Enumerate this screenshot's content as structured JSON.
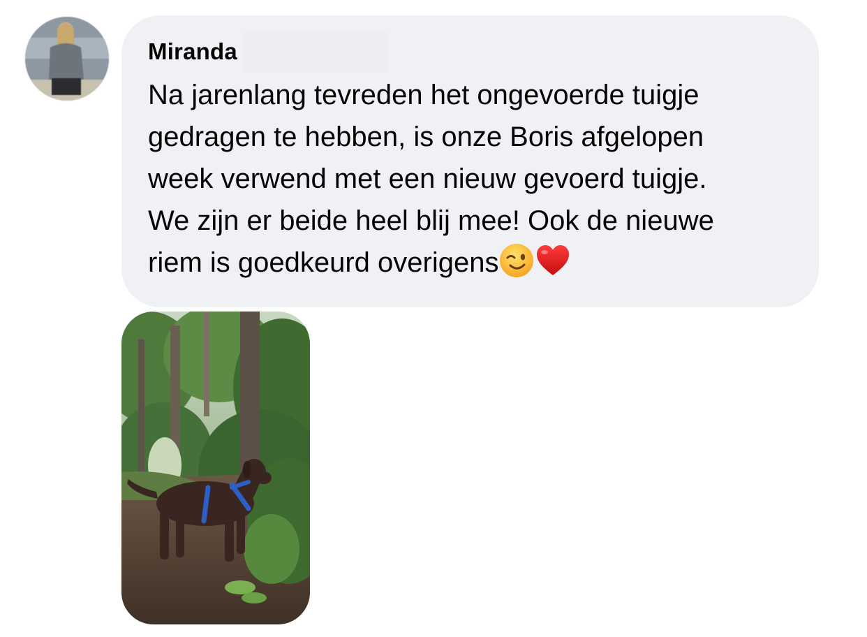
{
  "comment": {
    "author_name": "Miranda",
    "message_lines": [
      "Na jarenlang tevreden het ongevoerde tuigje",
      "gedragen te hebben, is onze Boris afgelopen",
      "week verwend met een nieuw gevoerd tuigje.",
      "We zijn er beide heel blij mee! Ook de nieuwe",
      "riem is goedkeurd overigens"
    ],
    "emojis": [
      "winking-face",
      "red-heart"
    ]
  },
  "colors": {
    "bubble_bg": "#f0f1f5",
    "text": "#050505",
    "harness": "#2d5fc4"
  }
}
